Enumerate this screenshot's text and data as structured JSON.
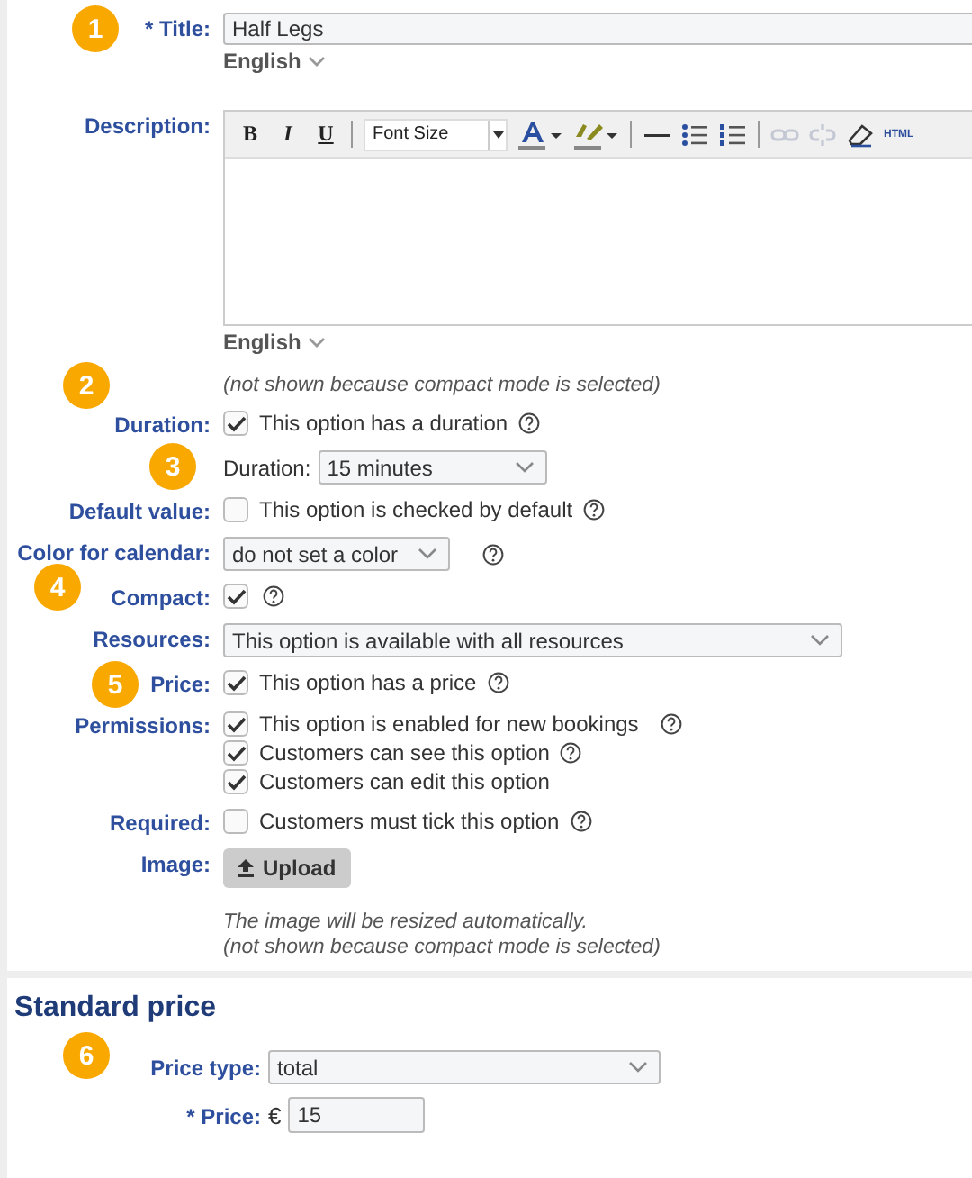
{
  "form": [
    {
      "kind": "text",
      "label": "* Title:",
      "badge": "1",
      "value": "Half Legs",
      "language": "English"
    },
    {
      "kind": "editor",
      "label": "Description:",
      "format_buttons": [
        "B",
        "I",
        "U"
      ],
      "font_size": "Font Size",
      "html": "HTML",
      "language": "English"
    },
    {
      "kind": "note",
      "lines": [
        "(not shown because compact mode is selected)"
      ]
    },
    {
      "kind": "checks",
      "label": "Duration:",
      "badge": "2",
      "options": [
        {
          "text": "This option has a duration",
          "checked": true,
          "help": true
        }
      ]
    },
    {
      "kind": "inline_select",
      "badge": "3",
      "label": "Duration:",
      "value": "15 minutes"
    },
    {
      "kind": "checks",
      "label": "Default value:",
      "options": [
        {
          "text": "This option is checked by default",
          "checked": false,
          "help": true
        }
      ]
    },
    {
      "kind": "select",
      "label": "Color for calendar:",
      "value": "do not set a color",
      "help": true
    },
    {
      "kind": "checks",
      "label": "Compact:",
      "badge": "4",
      "options": [
        {
          "checked": true,
          "help": true
        }
      ]
    },
    {
      "kind": "select",
      "label": "Resources:",
      "value": "This option is available with all resources",
      "help": false
    },
    {
      "kind": "checks",
      "label": "Price:",
      "badge": "5",
      "options": [
        {
          "text": "This option has a price",
          "checked": true,
          "help": true
        }
      ]
    },
    {
      "kind": "checks",
      "label": "Permissions:",
      "options": [
        {
          "text": "This option is enabled for new bookings",
          "checked": true,
          "help": true
        },
        {
          "text": "Customers can see this option",
          "checked": true,
          "help": true
        },
        {
          "text": "Customers can edit this option",
          "checked": true,
          "help": false
        }
      ]
    },
    {
      "kind": "checks",
      "label": "Required:",
      "options": [
        {
          "text": "Customers must tick this option",
          "checked": false,
          "help": true
        }
      ]
    },
    {
      "kind": "upload",
      "label": "Image:",
      "button": "Upload",
      "notes": [
        "The image will be resized automatically.",
        "(not shown because compact mode is selected)"
      ]
    }
  ],
  "section": {
    "title": "Standard price",
    "rows": [
      {
        "kind": "select",
        "badge": "6",
        "label": "Price type:",
        "value": "total"
      },
      {
        "kind": "price",
        "label": "* Price:",
        "currency": "€",
        "value": "15"
      }
    ]
  }
}
